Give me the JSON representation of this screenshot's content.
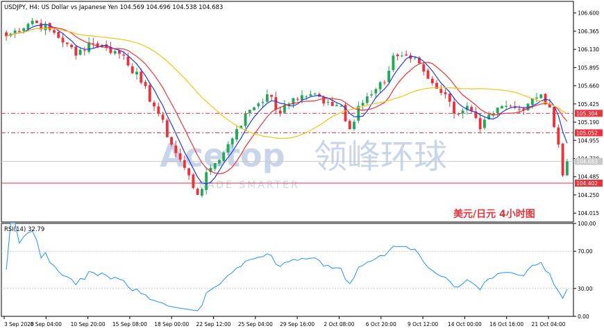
{
  "chart_data": {
    "type": "candlestick",
    "symbol_header": "USDJPY, H4:  US Dollar vs Japanese Yen  104.569 104.696 104.538 104.683",
    "overlay_caption": "美元/日元  4小时图",
    "watermark": {
      "brand": "Acetop",
      "cn": "领峰环球",
      "tagline": "TRADE SMARTER"
    },
    "price_axis": {
      "ylim": [
        103.9,
        106.75
      ],
      "ticks": [
        106.6,
        106.365,
        106.13,
        105.895,
        105.66,
        105.425,
        105.19,
        104.955,
        104.72,
        104.485,
        104.25,
        104.015
      ],
      "tick_labels": [
        "106.600",
        "106.365",
        "106.130",
        "105.895",
        "105.660",
        "105.425",
        "105.190",
        "104.955",
        "104.720",
        "104.485",
        "104.250",
        "104.015"
      ]
    },
    "levels": [
      {
        "value": 105.304,
        "label": "105.304",
        "style": "dash-dot",
        "color": "#e8323c"
      },
      {
        "value": 105.052,
        "label": "105.052",
        "style": "dash-dot",
        "color": "#e8323c"
      },
      {
        "value": 104.683,
        "label": "104.683",
        "style": "solid",
        "color": "#c8c8c8"
      },
      {
        "value": 104.402,
        "label": "104.402",
        "style": "solid",
        "color": "#e8323c"
      }
    ],
    "x_labels": [
      "3 Sep 2020",
      "8 Sep 04:00",
      "10 Sep 20:00",
      "15 Sep 08:00",
      "18 Sep 00:00",
      "22 Sep 12:00",
      "25 Sep 04:00",
      "29 Sep 16:00",
      "2 Oct 08:00",
      "6 Oct 20:00",
      "9 Oct 12:00",
      "14 Oct 00:00",
      "16 Oct 16:00",
      "21 Oct 04:00"
    ],
    "close_anchors": [
      [
        0,
        106.3
      ],
      [
        6,
        106.5
      ],
      [
        10,
        106.38
      ],
      [
        14,
        106.2
      ],
      [
        16,
        106.05
      ],
      [
        19,
        106.22
      ],
      [
        23,
        106.15
      ],
      [
        27,
        106.05
      ],
      [
        31,
        105.7
      ],
      [
        35,
        105.3
      ],
      [
        38,
        104.9
      ],
      [
        41,
        104.6
      ],
      [
        44,
        104.25
      ],
      [
        47,
        104.6
      ],
      [
        50,
        104.8
      ],
      [
        53,
        105.1
      ],
      [
        56,
        105.35
      ],
      [
        60,
        105.55
      ],
      [
        63,
        105.3
      ],
      [
        66,
        105.5
      ],
      [
        70,
        105.55
      ],
      [
        74,
        105.45
      ],
      [
        77,
        105.4
      ],
      [
        79,
        105.1
      ],
      [
        81,
        105.4
      ],
      [
        84,
        105.55
      ],
      [
        87,
        105.7
      ],
      [
        89,
        106.05
      ],
      [
        92,
        106.05
      ],
      [
        95,
        105.95
      ],
      [
        97,
        105.75
      ],
      [
        101,
        105.55
      ],
      [
        103,
        105.3
      ],
      [
        106,
        105.4
      ],
      [
        109,
        105.1
      ],
      [
        112,
        105.3
      ],
      [
        115,
        105.4
      ],
      [
        118,
        105.35
      ],
      [
        121,
        105.5
      ],
      [
        123,
        105.55
      ],
      [
        125,
        105.38
      ],
      [
        127,
        104.9
      ],
      [
        128,
        104.5
      ],
      [
        129,
        104.683
      ]
    ],
    "rsi": {
      "label": "RSI(14) 32.79",
      "ylim": [
        0,
        100
      ],
      "ticks": [
        100,
        70,
        30,
        0
      ],
      "tick_labels": [
        "100.00",
        "70.00",
        "30.00",
        "0.00"
      ],
      "levels": [
        70,
        30
      ],
      "color": "#1e90ff"
    },
    "colors": {
      "bull": "#26a65b",
      "bear": "#e8323c",
      "ma_fast": "#1c39e8",
      "ma_mid": "#e8323c",
      "ma_slow": "#f0c419",
      "axis": "#000000",
      "grid": "#c8c8c8",
      "watermark": "#c9d6ea",
      "caption": "#e8323c"
    }
  }
}
